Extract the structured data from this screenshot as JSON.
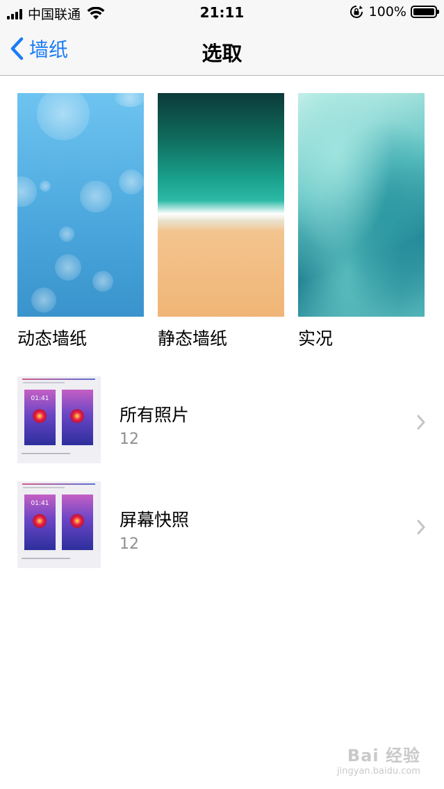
{
  "status_bar": {
    "carrier": "中国联通",
    "time": "21:11",
    "battery_percent": "100%",
    "battery_level": 1.0
  },
  "nav": {
    "back_label": "墙纸",
    "title": "选取"
  },
  "wallpapers": [
    {
      "label": "动态墙纸"
    },
    {
      "label": "静态墙纸"
    },
    {
      "label": "实况"
    }
  ],
  "albums": [
    {
      "title": "所有照片",
      "count": "12",
      "thumb_time": "01:41"
    },
    {
      "title": "屏幕快照",
      "count": "12",
      "thumb_time": "01:41"
    }
  ],
  "watermark": {
    "main": "Bai 经验",
    "sub": "jingyan.baidu.com"
  },
  "colors": {
    "accent": "#1a7cf5",
    "secondary_text": "#8e8e93",
    "bar_background": "#f7f7f7"
  },
  "icons": [
    "signal-icon",
    "wifi-icon",
    "rotation-lock-icon",
    "battery-icon",
    "back-chevron-icon",
    "chevron-right-icon"
  ]
}
